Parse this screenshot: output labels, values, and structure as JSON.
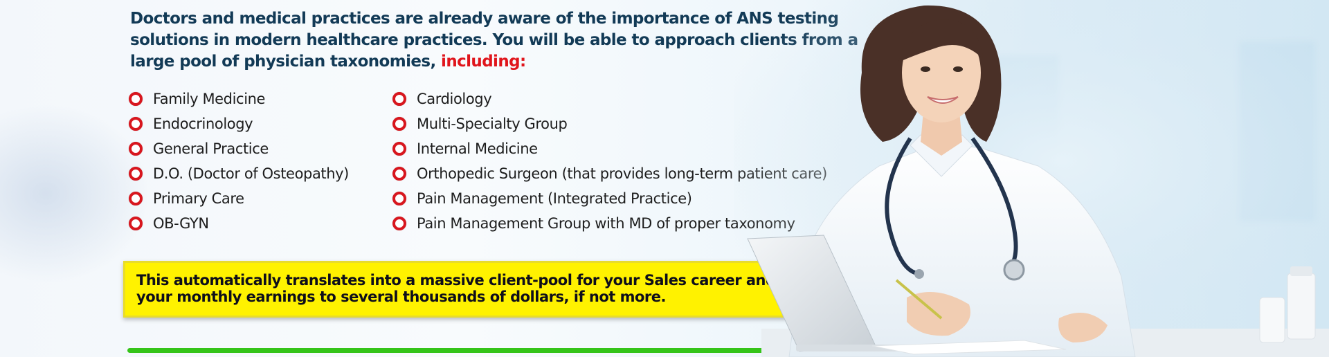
{
  "headline": {
    "text": "Doctors and medical practices are already aware of the importance of ANS testing solutions in modern healthcare practices. You will be able to approach clients from a large pool of physician taxonomies,",
    "accent": "including:"
  },
  "taxonomies_left": [
    "Family Medicine",
    "Endocrinology",
    "General Practice",
    "D.O. (Doctor of Osteopathy)",
    "Primary Care",
    "OB-GYN"
  ],
  "taxonomies_right": [
    "Cardiology",
    "Multi-Specialty Group",
    "Internal Medicine",
    "Orthopedic Surgeon (that provides long-term patient care)",
    "Pain Management (Integrated Practice)",
    "Pain Management Group with MD of proper taxonomy"
  ],
  "callout": {
    "text": "This automatically translates into a massive client-pool for your Sales career and will take your monthly earnings to several thousands of dollars, if not more."
  },
  "colors": {
    "headline": "#123a56",
    "accent": "#e0151c",
    "bullet": "#d8161e",
    "callout_bg": "#fff200",
    "divider": "#35c419"
  },
  "image": {
    "subject": "smiling female doctor in white coat with stethoscope writing at desk with laptop"
  }
}
